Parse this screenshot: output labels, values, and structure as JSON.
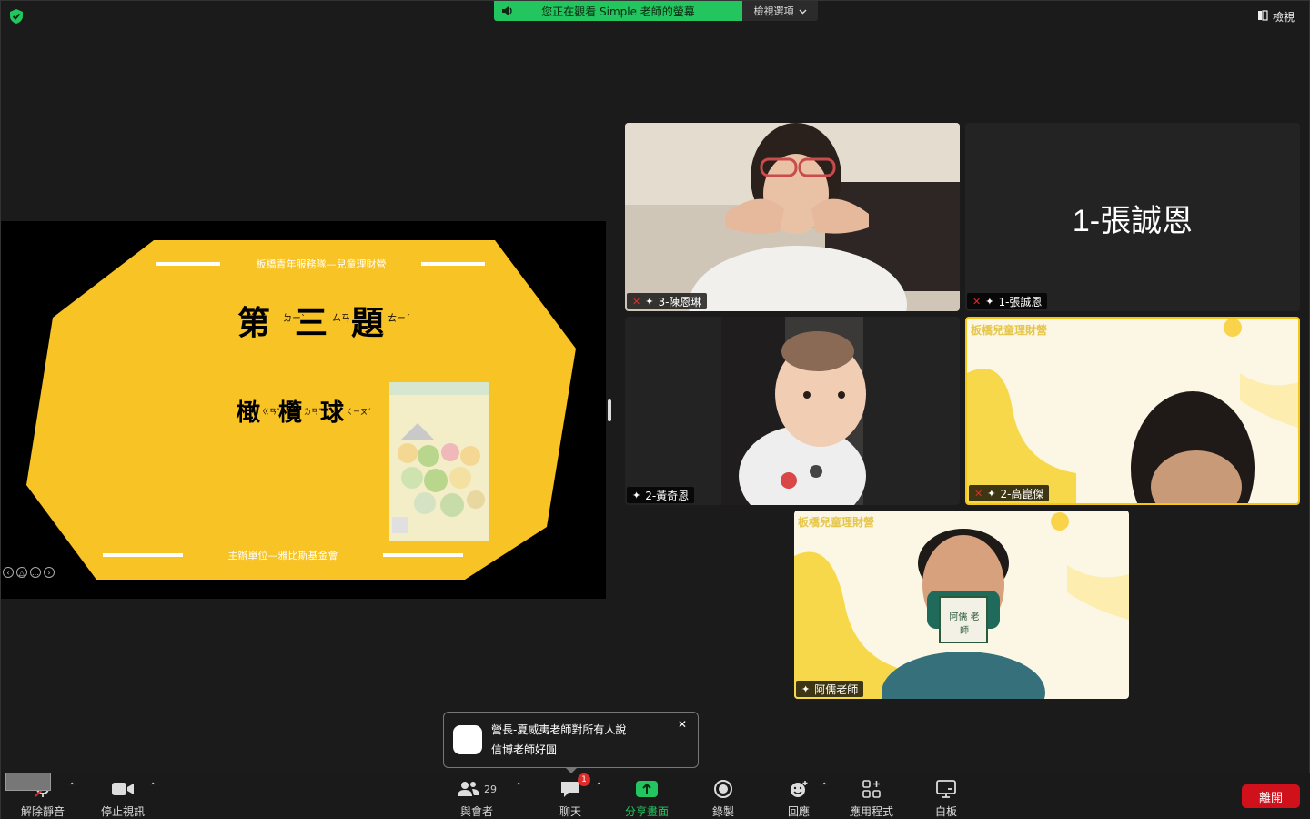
{
  "banner": {
    "share_text": "您正在觀看 Simple 老師的螢幕",
    "view_options": "檢視選項"
  },
  "header": {
    "view_label": "檢視"
  },
  "slide": {
    "org_title": "板橋青年服務隊—兒童理財營",
    "heading": "第三題",
    "heading_chars": [
      "第",
      "三",
      "題"
    ],
    "heading_zhuyin": [
      "ㄉㄧˋ",
      "ㄙㄢ",
      "ㄊㄧˊ"
    ],
    "answer_chars": [
      "橄",
      "欖",
      "球"
    ],
    "answer_zhuyin": [
      "ㄍㄢˇ",
      "ㄌㄢˇ",
      "ㄑㄧㄡˊ"
    ],
    "footer": "主辦單位—雅比斯基金會",
    "colors": {
      "yellow": "#f8c325",
      "black": "#000000"
    }
  },
  "tiles": [
    {
      "name": "3-陳恩琳",
      "muted": true,
      "pinned": true
    },
    {
      "name": "1-張誠恩",
      "big_name": "1-張誠恩",
      "muted": true,
      "pinned": true
    },
    {
      "name": "2-黃奇恩",
      "muted": false,
      "pinned": true
    },
    {
      "name": "2-高崑傑",
      "muted": true,
      "pinned": true,
      "bg_text": "板橋兒童理財營"
    },
    {
      "name": "阿儒老師",
      "muted": false,
      "pinned": true,
      "bg_text": "板橋兒童理財營",
      "card_text": "阿儒 老師"
    }
  ],
  "chat": {
    "from": "營長-夏威夷老師對所有人說",
    "message": "信博老師好圓"
  },
  "toolbar": {
    "unmute": "解除靜音",
    "stop_video": "停止視訊",
    "participants": "與會者",
    "participant_count": "29",
    "chat": "聊天",
    "chat_badge": "1",
    "share": "分享畫面",
    "record": "錄製",
    "reactions": "回應",
    "apps": "應用程式",
    "whiteboard": "白板",
    "leave": "離開"
  }
}
